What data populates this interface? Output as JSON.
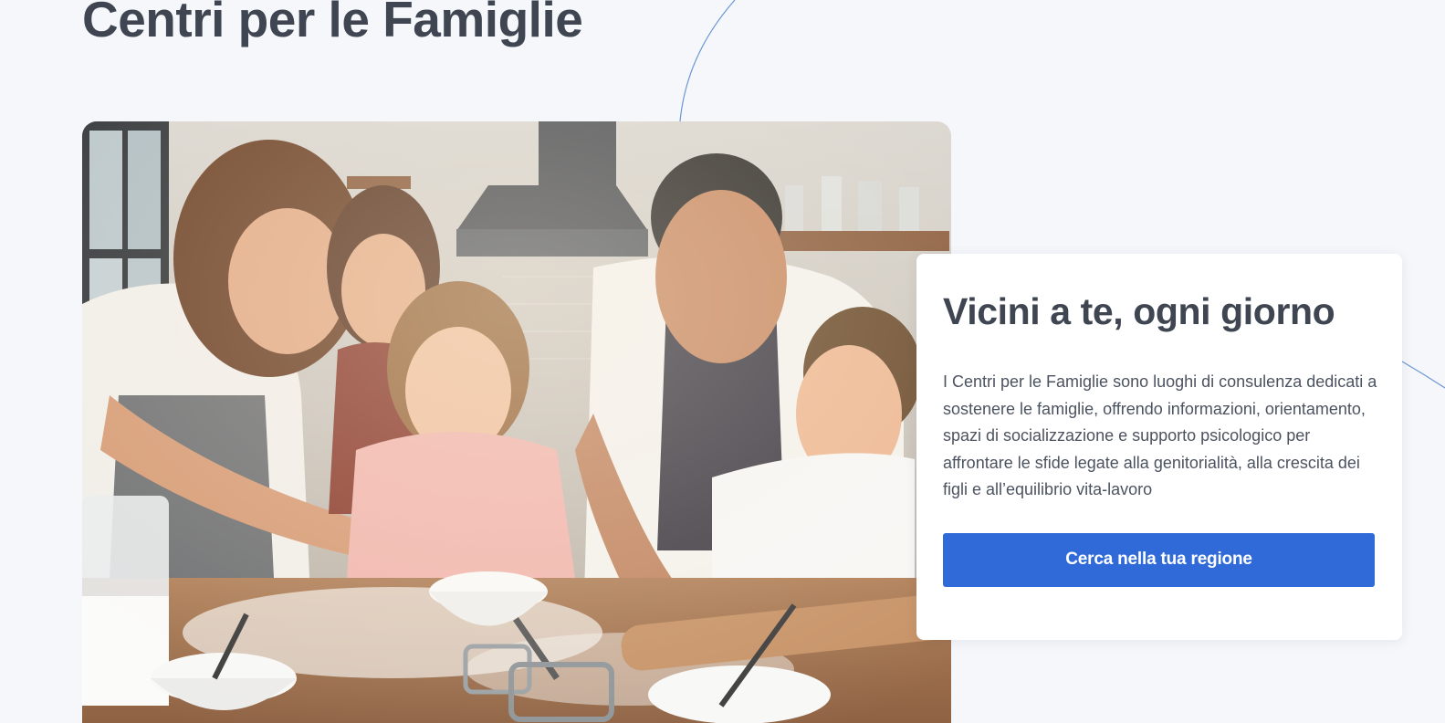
{
  "page": {
    "title": "Centri per le Famiglie"
  },
  "hero": {
    "image_alt": "Family baking together in a kitchen"
  },
  "card": {
    "title": "Vicini a te, ogni giorno",
    "body": "I Centri per le Famiglie sono luoghi di consulenza dedicati a sostenere le famiglie, offrendo informazioni, orientamento, spazi di socializzazione e supporto psicologico per affrontare le sfide legate alla genitorialità, alla crescita dei figli e all’equilibrio vita-lavoro",
    "button_label": "Cerca nella tua regione"
  },
  "colors": {
    "background": "#f5f7fb",
    "title": "#3f4652",
    "text": "#4c5360",
    "primary": "#2f6ad8",
    "decor_line": "#5b8fd8"
  }
}
